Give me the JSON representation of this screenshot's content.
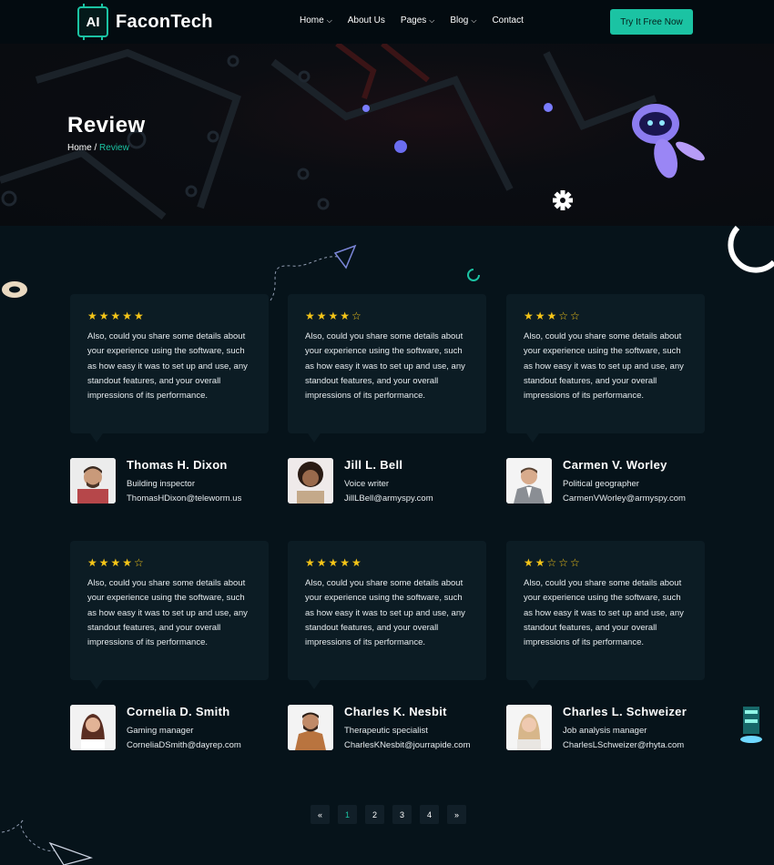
{
  "brand": {
    "logo_mark": "AI",
    "name": "FaconTech"
  },
  "nav": {
    "items": [
      {
        "label": "Home",
        "dropdown": true
      },
      {
        "label": "About Us",
        "dropdown": false
      },
      {
        "label": "Pages",
        "dropdown": true
      },
      {
        "label": "Blog",
        "dropdown": true
      },
      {
        "label": "Contact",
        "dropdown": false
      }
    ],
    "cta_label": "Try It Free Now"
  },
  "hero": {
    "title": "Review",
    "breadcrumb": {
      "home": "Home",
      "separator": "/",
      "current": "Review"
    }
  },
  "reviews": [
    {
      "rating": 5,
      "stars": "★★★★★",
      "text": "Also, could you share some details about your experience using the software, such as how easy it was to set up and use, any standout features, and your overall impressions of its performance.",
      "name": "Thomas H. Dixon",
      "role": "Building inspector",
      "email": "ThomasHDixon@teleworm.us"
    },
    {
      "rating": 4,
      "stars": "★★★★☆",
      "text": "Also, could you share some details about your experience using the software, such as how easy it was to set up and use, any standout features, and your overall impressions of its performance.",
      "name": "Jill L. Bell",
      "role": "Voice writer",
      "email": "JillLBell@armyspy.com"
    },
    {
      "rating": 3,
      "stars": "★★★☆☆",
      "text": "Also, could you share some details about your experience using the software, such as how easy it was to set up and use, any standout features, and your overall impressions of its performance.",
      "name": "Carmen V. Worley",
      "role": "Political geographer",
      "email": "CarmenVWorley@armyspy.com"
    },
    {
      "rating": 4,
      "stars": "★★★★☆",
      "text": "Also, could you share some details about your experience using the software, such as how easy it was to set up and use, any standout features, and your overall impressions of its performance.",
      "name": "Cornelia D. Smith",
      "role": "Gaming manager",
      "email": "CorneliaDSmith@dayrep.com"
    },
    {
      "rating": 5,
      "stars": "★★★★★",
      "text": "Also, could you share some details about your experience using the software, such as how easy it was to set up and use, any standout features, and your overall impressions of its performance.",
      "name": "Charles K. Nesbit",
      "role": "Therapeutic specialist",
      "email": "CharlesKNesbit@jourrapide.com"
    },
    {
      "rating": 2,
      "stars": "★★☆☆☆",
      "text": "Also, could you share some details about your experience using the software, such as how easy it was to set up and use, any standout features, and your overall impressions of its performance.",
      "name": "Charles L. Schweizer",
      "role": "Job analysis manager",
      "email": "CharlesLSchweizer@rhyta.com"
    }
  ],
  "pagination": {
    "prev": "«",
    "pages": [
      "1",
      "2",
      "3",
      "4"
    ],
    "current": "1",
    "next": "»"
  },
  "colors": {
    "accent": "#1bc3a3",
    "star": "#f5c518",
    "background": "#06131a",
    "card": "#0c1c24"
  }
}
